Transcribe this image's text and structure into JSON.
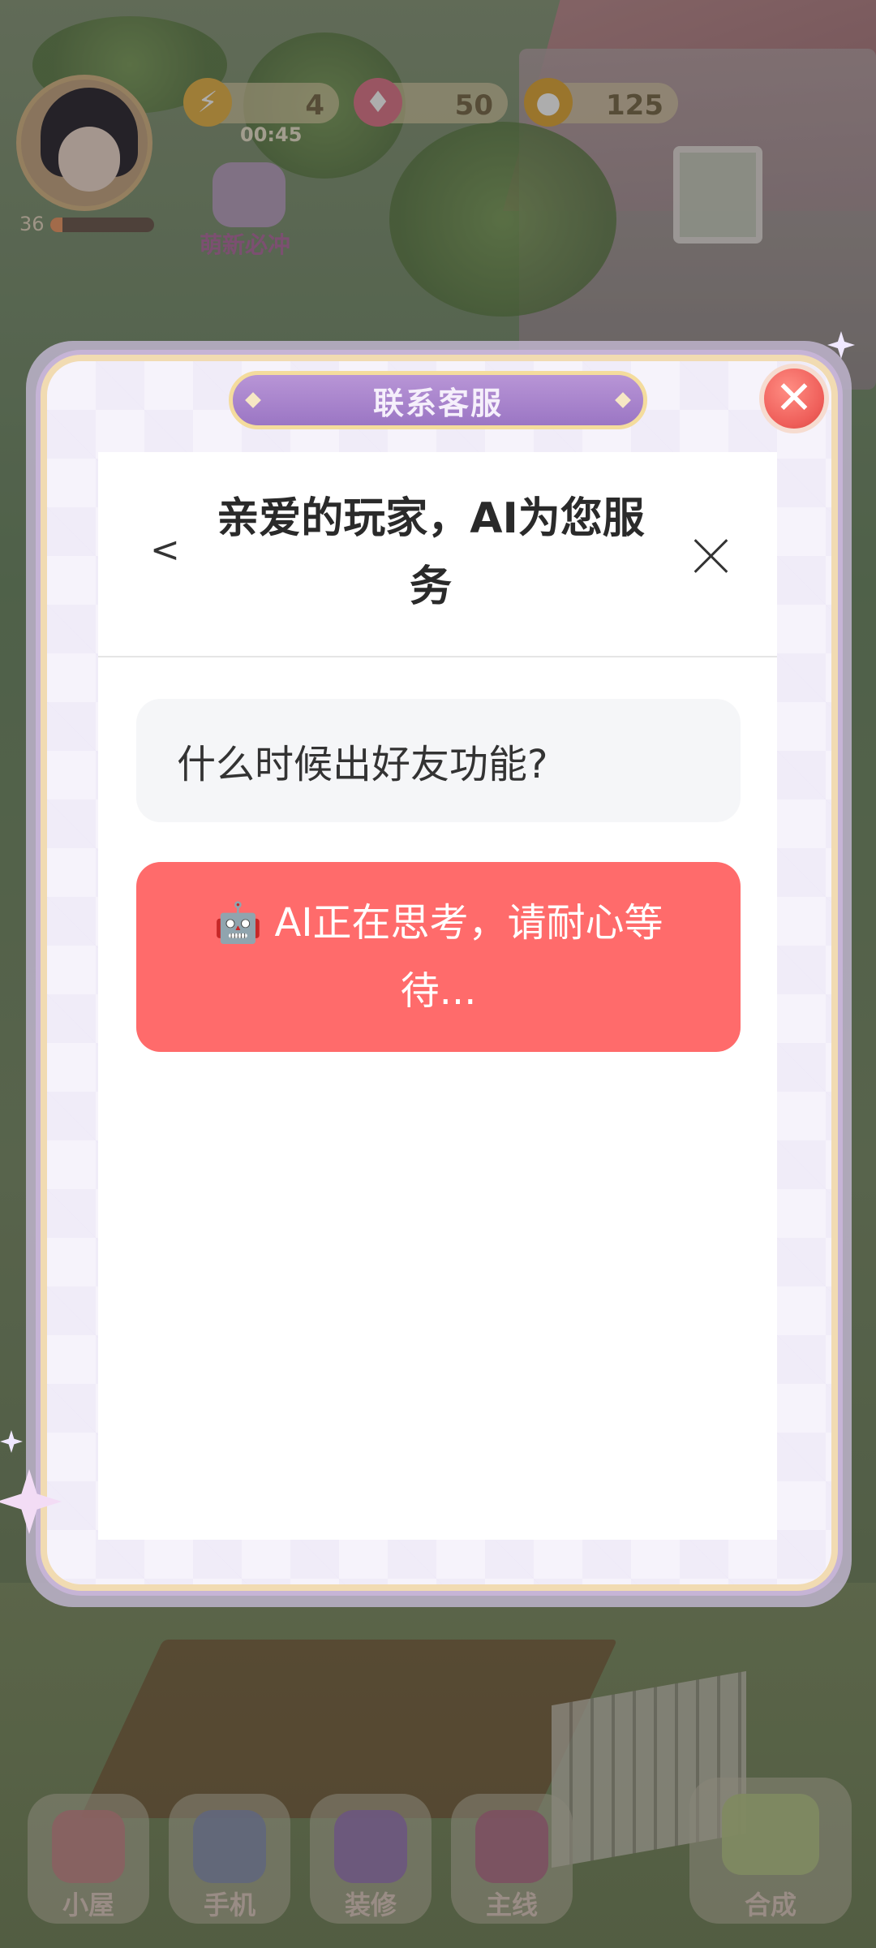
{
  "hud": {
    "level": "36",
    "level_progress": 0.12,
    "energy": "4",
    "energy_timer": "00:45",
    "gems": "50",
    "coins": "125",
    "event_label": "萌新必冲"
  },
  "dialog": {
    "title": "联系客服",
    "close_glyph": "✕"
  },
  "chat": {
    "back_glyph": "<",
    "header_title": "亲爱的玩家，AI为您服务",
    "user_message": "什么时候出好友功能?",
    "ai_status": "🤖 AI正在思考，请耐心等待..."
  },
  "bottom_nav": {
    "items": [
      {
        "label": "小屋",
        "icon": "house-icon"
      },
      {
        "label": "手机",
        "icon": "phone-icon"
      },
      {
        "label": "装修",
        "icon": "brush-icon"
      },
      {
        "label": "主线",
        "icon": "book-icon"
      },
      {
        "label": "合成",
        "icon": "teacup-icon"
      }
    ]
  },
  "colors": {
    "ai_bubble": "#ff6b6b",
    "user_bubble": "#f5f6f8",
    "ribbon": "#9b76c4",
    "close_button": "#ef5f5a"
  }
}
